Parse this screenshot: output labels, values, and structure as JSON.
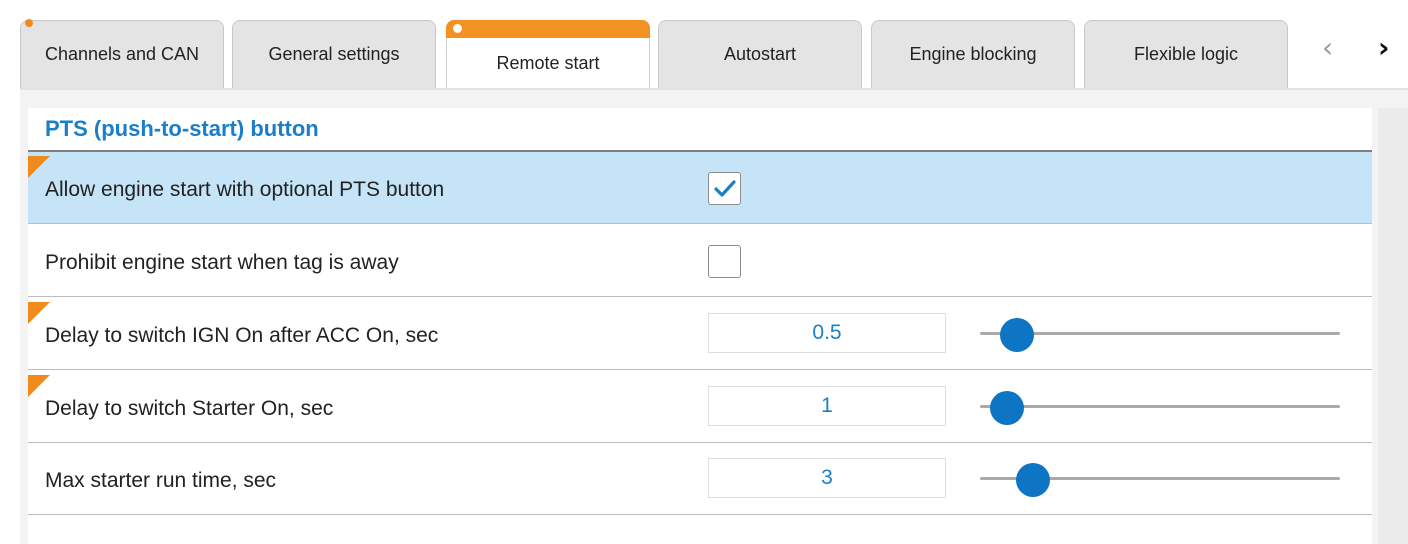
{
  "tabs": [
    {
      "label": "Channels and CAN",
      "active": false,
      "dot": true
    },
    {
      "label": "General settings",
      "active": false,
      "dot": false
    },
    {
      "label": "Remote start",
      "active": true,
      "dot": true
    },
    {
      "label": "Autostart",
      "active": false,
      "dot": false
    },
    {
      "label": "Engine blocking",
      "active": false,
      "dot": false
    },
    {
      "label": "Flexible logic",
      "active": false,
      "dot": false
    }
  ],
  "nav": {
    "prev_icon": "chevron-left-icon",
    "next_icon": "chevron-right-icon",
    "prev_glyph": "‹",
    "next_glyph": "›"
  },
  "section": {
    "title": "PTS (push-to-start) button"
  },
  "settings": [
    {
      "label": "Allow engine start with optional PTS button",
      "type": "checkbox",
      "checked": true,
      "highlighted": true,
      "changed": true
    },
    {
      "label": "Prohibit engine start when tag is away",
      "type": "checkbox",
      "checked": false,
      "highlighted": false,
      "changed": false
    },
    {
      "label": "Delay to switch IGN On after ACC On, sec",
      "type": "slider",
      "value": "0.5",
      "level": 0.06,
      "changed": true
    },
    {
      "label": "Delay to switch Starter On, sec",
      "type": "slider",
      "value": "1",
      "level": 0.03,
      "changed": true
    },
    {
      "label": "Max starter run time, sec",
      "type": "slider",
      "value": "3",
      "level": 0.11,
      "changed": false
    }
  ],
  "colors": {
    "accent": "#1a7fc8",
    "active_tab": "#f39122",
    "changed_flag": "#f08a1c",
    "highlight_row": "#c6e4f7",
    "slider_thumb": "#0e74c4"
  }
}
